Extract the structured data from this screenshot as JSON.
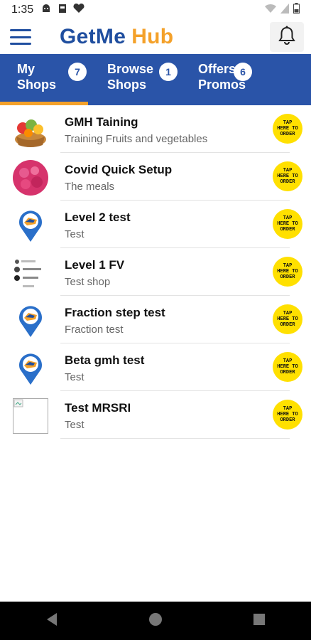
{
  "status_bar": {
    "time": "1:35",
    "icons": [
      "android-icon",
      "sd-card-icon",
      "heart-icon"
    ],
    "right_icons": [
      "wifi-icon",
      "signal-icon",
      "battery-icon"
    ]
  },
  "header": {
    "brand_part1": "GetMe",
    "brand_part2": "Hub",
    "colors": {
      "primary": "#1f4e9f",
      "accent": "#f4a12a"
    }
  },
  "tabs": [
    {
      "label": "My\nShops",
      "badge": "7",
      "active": true
    },
    {
      "label": "Browse\nShops",
      "badge": "1",
      "active": false
    },
    {
      "label": "Offers\nPromos",
      "badge": "6",
      "active": false
    }
  ],
  "shops": [
    {
      "title": "GMH Taining",
      "subtitle": "Training Fruits and vegetables",
      "thumb": "fruit-basket"
    },
    {
      "title": "Covid Quick Setup",
      "subtitle": "The meals",
      "thumb": "pink-food"
    },
    {
      "title": "Level 2 test",
      "subtitle": "Test",
      "thumb": "location-pin"
    },
    {
      "title": "Level 1 FV",
      "subtitle": "Test shop",
      "thumb": "screenshot"
    },
    {
      "title": "Fraction step test",
      "subtitle": "Fraction test",
      "thumb": "location-pin"
    },
    {
      "title": "Beta gmh test",
      "subtitle": "Test",
      "thumb": "location-pin"
    },
    {
      "title": "Test MRSRI",
      "subtitle": "Test",
      "thumb": "broken-image"
    }
  ],
  "order_badge_text": "TAP\nHERE TO\nORDER",
  "nav": [
    "back-icon",
    "home-icon",
    "recents-icon"
  ]
}
